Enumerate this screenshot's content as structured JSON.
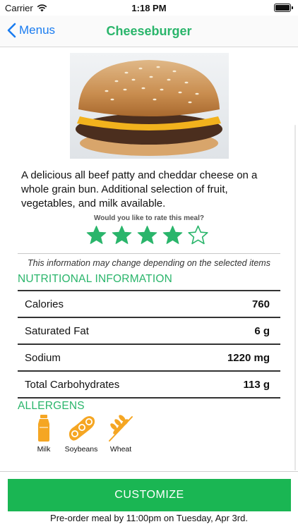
{
  "status_bar": {
    "carrier": "Carrier",
    "time": "1:18 PM"
  },
  "nav": {
    "back_label": "Menus",
    "title": "Cheeseburger"
  },
  "meal": {
    "description": "A delicious all beef patty and cheddar cheese on a whole grain bun. Additional selection of fruit, vegetables, and milk available.",
    "rate_prompt": "Would you like to rate this meal?",
    "rating": 4,
    "rating_max": 5,
    "disclaimer": "This information may change depending on the selected items"
  },
  "nutrition": {
    "title": "NUTRITIONAL INFORMATION",
    "rows": [
      {
        "label": "Calories",
        "value": "760"
      },
      {
        "label": "Saturated Fat",
        "value": "6 g"
      },
      {
        "label": "Sodium",
        "value": "1220 mg"
      },
      {
        "label": "Total Carbohydrates",
        "value": "113 g"
      }
    ]
  },
  "allergens": {
    "title": "ALLERGENS",
    "items": [
      {
        "label": "Milk",
        "icon": "milk-bottle-icon"
      },
      {
        "label": "Soybeans",
        "icon": "soybean-icon"
      },
      {
        "label": "Wheat",
        "icon": "wheat-icon"
      }
    ]
  },
  "colors": {
    "accent": "#2ab56b",
    "button": "#1ab653",
    "link": "#1a7cf0",
    "allergen_icon": "#f5a623"
  },
  "footer": {
    "customize_label": "CUSTOMIZE",
    "preorder_text": "Pre-order meal by 11:00pm on Tuesday, Apr 3rd."
  }
}
